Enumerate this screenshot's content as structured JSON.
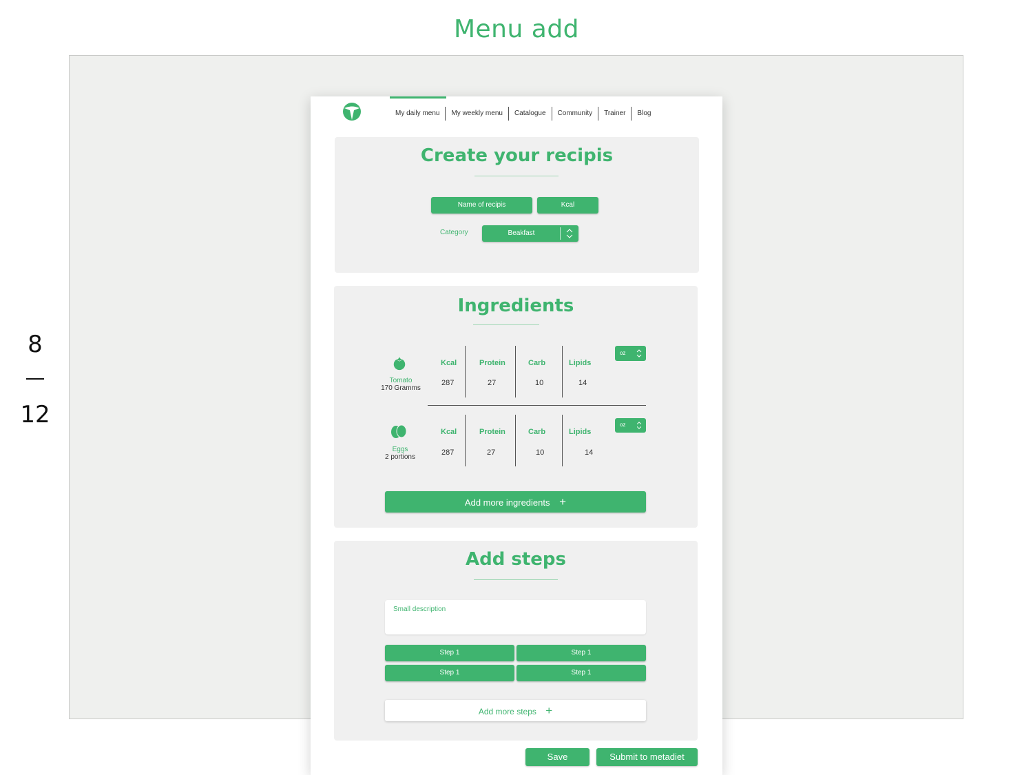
{
  "page_heading": "Menu add",
  "counter": {
    "current": "8",
    "total": "12"
  },
  "colors": {
    "accent": "#3fb46f",
    "canvas": "#eff0ee",
    "card": "#f0f0f0"
  },
  "nav": {
    "active_index": 0,
    "items": [
      {
        "label": "My daily menu"
      },
      {
        "label": "My weekly menu"
      },
      {
        "label": "Catalogue"
      },
      {
        "label": "Community"
      },
      {
        "label": "Trainer"
      },
      {
        "label": "Blog"
      }
    ]
  },
  "create": {
    "title": "Create your recipis",
    "name_button": "Name of recipis",
    "kcal_button": "Kcal",
    "category_label": "Category",
    "category_value": "Beakfast"
  },
  "ingredients": {
    "title": "Ingredients",
    "headers": {
      "kcal": "Kcal",
      "protein": "Protein",
      "carb": "Carb",
      "lipids": "Lipids"
    },
    "items": [
      {
        "name": "Tomato",
        "quantity": "170 Gramms",
        "icon": "tomato-icon",
        "kcal": "287",
        "protein": "27",
        "carb": "10",
        "lipids": "14",
        "unit": "oz"
      },
      {
        "name": "Eggs",
        "quantity": "2 portions",
        "icon": "eggs-icon",
        "kcal": "287",
        "protein": "27",
        "carb": "10",
        "lipids": "14",
        "unit": "oz"
      }
    ],
    "add_more": "Add more ingredients"
  },
  "steps": {
    "title": "Add steps",
    "description_placeholder": "Small description",
    "buttons": [
      "Step 1",
      "Step 1",
      "Step 1",
      "Step 1"
    ],
    "add_more": "Add more steps"
  },
  "actions": {
    "save": "Save",
    "submit": "Submit to metadiet"
  }
}
